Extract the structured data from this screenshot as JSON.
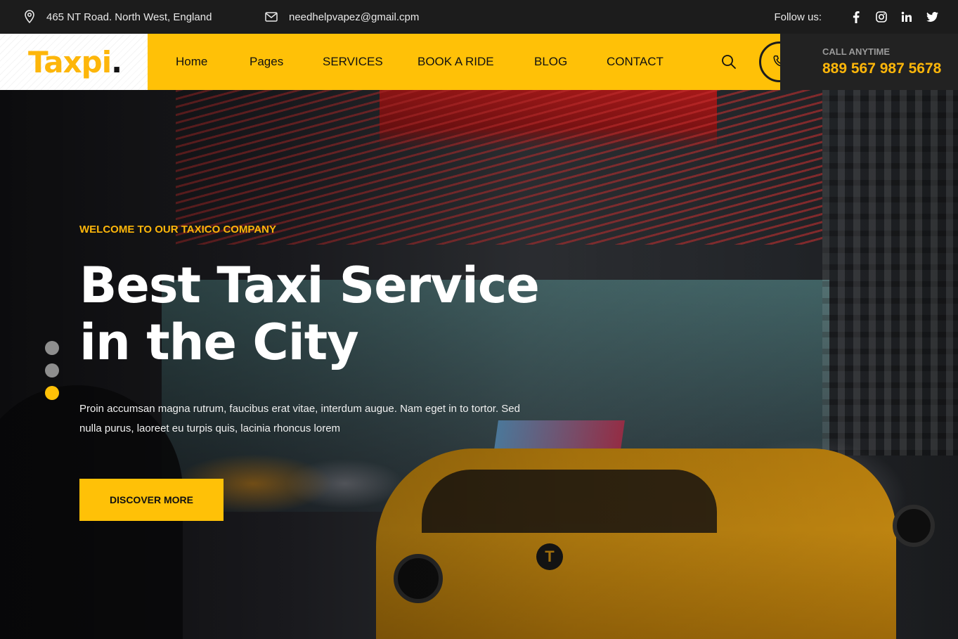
{
  "topbar": {
    "address": "465 NT Road. North West, England",
    "email": "needhelpvapez@gmail.cpm",
    "follow_label": "Follow us:",
    "social": [
      "facebook-icon",
      "instagram-icon",
      "linkedin-icon",
      "twitter-icon"
    ]
  },
  "header": {
    "logo_text": "Taxpi",
    "logo_dot": ".",
    "nav": [
      "Home",
      "Pages",
      "SERVICES",
      "BOOK A RIDE",
      "BLOG",
      "CONTACT"
    ],
    "call_label": "CALL ANYTIME",
    "call_number": "889 567 987 5678"
  },
  "hero": {
    "eyebrow": "WELCOME TO OUR TAXICO COMPANY",
    "headline_line1": "Best Taxi Service",
    "headline_line2": "in the City",
    "description": "Proin accumsan magna rutrum, faucibus erat vitae, interdum augue. Nam eget in to tortor. Sed nulla purus, laoreet eu turpis quis, lacinia rhoncus lorem",
    "cta_label": "DISCOVER MORE",
    "slides_total": 3,
    "active_slide": 3
  },
  "colors": {
    "accent": "#ffc107",
    "accent_text": "#fdb60a",
    "topbar_bg": "#1c1c1c",
    "call_bg": "#222222"
  }
}
